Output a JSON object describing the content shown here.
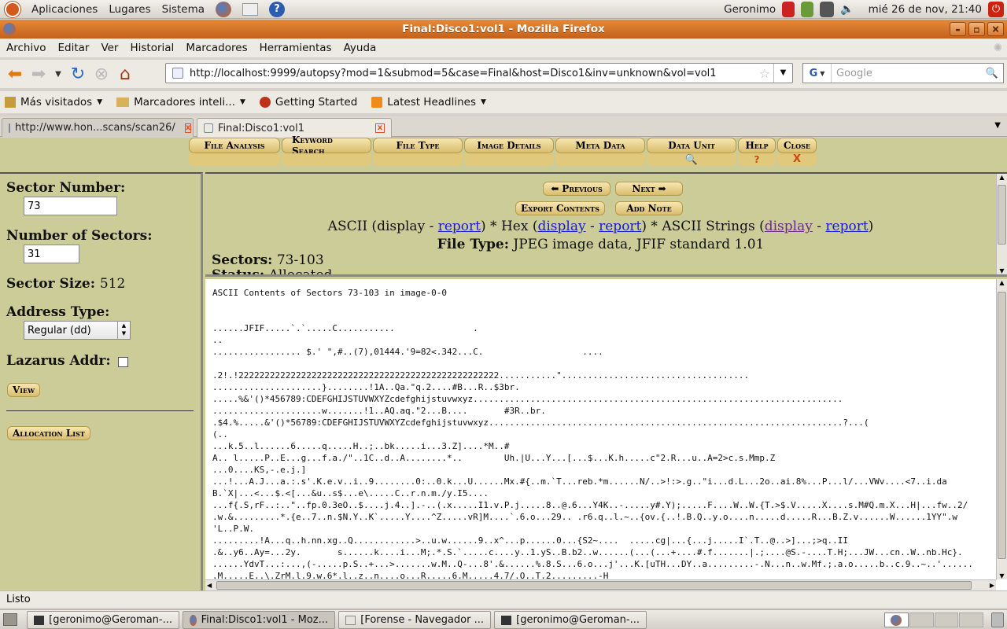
{
  "panel": {
    "applications": "Aplicaciones",
    "places": "Lugares",
    "system": "Sistema",
    "user": "Geronimo",
    "clock": "mié 26 de nov, 21:40"
  },
  "window": {
    "title": "Final:Disco1:vol1 - Mozilla Firefox"
  },
  "menubar": [
    "Archivo",
    "Editar",
    "Ver",
    "Historial",
    "Marcadores",
    "Herramientas",
    "Ayuda"
  ],
  "nav": {
    "url": "http://localhost:9999/autopsy?mod=1&submod=5&case=Final&host=Disco1&inv=unknown&vol=vol1",
    "search_placeholder": "Google"
  },
  "bookmarks": [
    "Más visitados",
    "Marcadores inteli...",
    "Getting Started",
    "Latest Headlines"
  ],
  "tabs": [
    "http://www.hon...scans/scan26/",
    "Final:Disco1:vol1"
  ],
  "topmenu": [
    "File Analysis",
    "Keyword Search",
    "File Type",
    "Image Details",
    "Meta Data",
    "Data Unit",
    "Help",
    "Close"
  ],
  "topmenu_sub": {
    "help": "?",
    "close": "X"
  },
  "left": {
    "sector_number_label": "Sector Number:",
    "sector_number": "73",
    "num_sectors_label": "Number of Sectors:",
    "num_sectors": "31",
    "sector_size_label": "Sector Size:",
    "sector_size": "512",
    "address_type_label": "Address Type:",
    "address_type": "Regular (dd)",
    "lazarus_label": "Lazarus Addr:",
    "view": "View",
    "allocation_list": "Allocation List"
  },
  "info": {
    "previous": "Previous",
    "next": "Next",
    "export": "Export Contents",
    "add_note": "Add Note",
    "ascii": "ASCII (display - ",
    "report": "report",
    "hex": ") * Hex (",
    "display": "display",
    "sep": " - ",
    "ascii_strings": ") * ASCII Strings (",
    "close_paren": ")",
    "file_type_label": "File Type:",
    "file_type": "JPEG image data, JFIF standard 1.01",
    "sectors_label": "Sectors:",
    "sectors": "73-103",
    "status_label": "Status:",
    "status": "Allocated"
  },
  "dump": {
    "heading": "ASCII Contents of Sectors 73-103 in image-0-0",
    "lines": [
      "",
      "",
      "......JFIF.....`.`.....C...........               .",
      "..",
      "................. $.' \",#..(7),01444.'9=82<.342...C.                   ....",
      "",
      ".2!.!22222222222222222222222222222222222222222222222222...........\"....................................",
      ".....................}........!1A..Qa.\"q.2....#B...R..$3br.",
      ".....%&'()*456789:CDEFGHIJSTUVWXYZcdefghijstuvwxyz.......................................................................",
      ".....................w.......!1..AQ.aq.\"2...B....       #3R..br.",
      ".$4.%.....&'()*56789:CDEFGHIJSTUVWXYZcdefghijstuvwxyz....................................................................?...(",
      "(..",
      "...k.5..l......6.....q.....H..;..bk.....i...3.Z]....*M..#",
      "A.. l.....P..E...g...f.a./\"..1C..d..A........*..        Uh.|U...Y...[...$...K.h.....c\"2.R...u..A=2>c.s.Mmp.Z",
      "...0....KS,-.e.j.]",
      "...!...A.J...a.:.s'.K.e.v..i..9........0:..0.k...U......Mx.#{..m.`T...reb.*m......N/..>!:>.g..\"i...d.L...2o..ai.8%...P...l/...VWv....<7..i.da",
      "B.`X|...<...$.<[...&u..s$...e\\.....C..r.n.m./y.I5....",
      "...f{.S,rF..:..\"..fp.0.3eO..$....j.4..].-..(.x.....I1.v.P.j.....8..@.6...Y4K..-.....y#.Y);.....F....W..W.{T.>$.V.....X....s.M#Q.m.X...H|...fw..2/",
      ".w.&.........*.{e..7..n.$N.Y..K`.....Y....^Z.....vR]M....`.6.o...29.. .r6.q..l.~..{ov.{..!.B.Q..y.o....n.....d.....R...B.Z.v......W......1YY\".w",
      "'L..P.W.",
      ".........!A...q..h.nn.xg..Q............>..u.w......9..x^...p......0...{S2~....  .....cg|...{...j.....I`.T..@..>]...;>q..II",
      ".&..y6..Ay=...2y.       s......k....i...M;.*.S.`.....c....y..1.yS..B.b2..w......(...(...+....#.f.......|.;....@S.-....T.H;...JW...cn..W..nb.Hc}.",
      "......YdvT...:...,(-.....p.S..+...>.......w.M..Q-...8'.&......%.8.S...6.o...j'...K.[uTH...DY..a.........-.N...n..w.Mf.;.a.o.....b..c.9..~..'......",
      ".M.....E..\\.ZrM.l.9.w.6*.l..z..n....o...R.....6.M.....4.7/.O..T.2.........-H"
    ]
  },
  "statusbar": "Listo",
  "taskbar": [
    "[geronimo@Geroman-...",
    "Final:Disco1:vol1 - Moz...",
    "[Forense - Navegador ...",
    "[geronimo@Geroman-..."
  ]
}
